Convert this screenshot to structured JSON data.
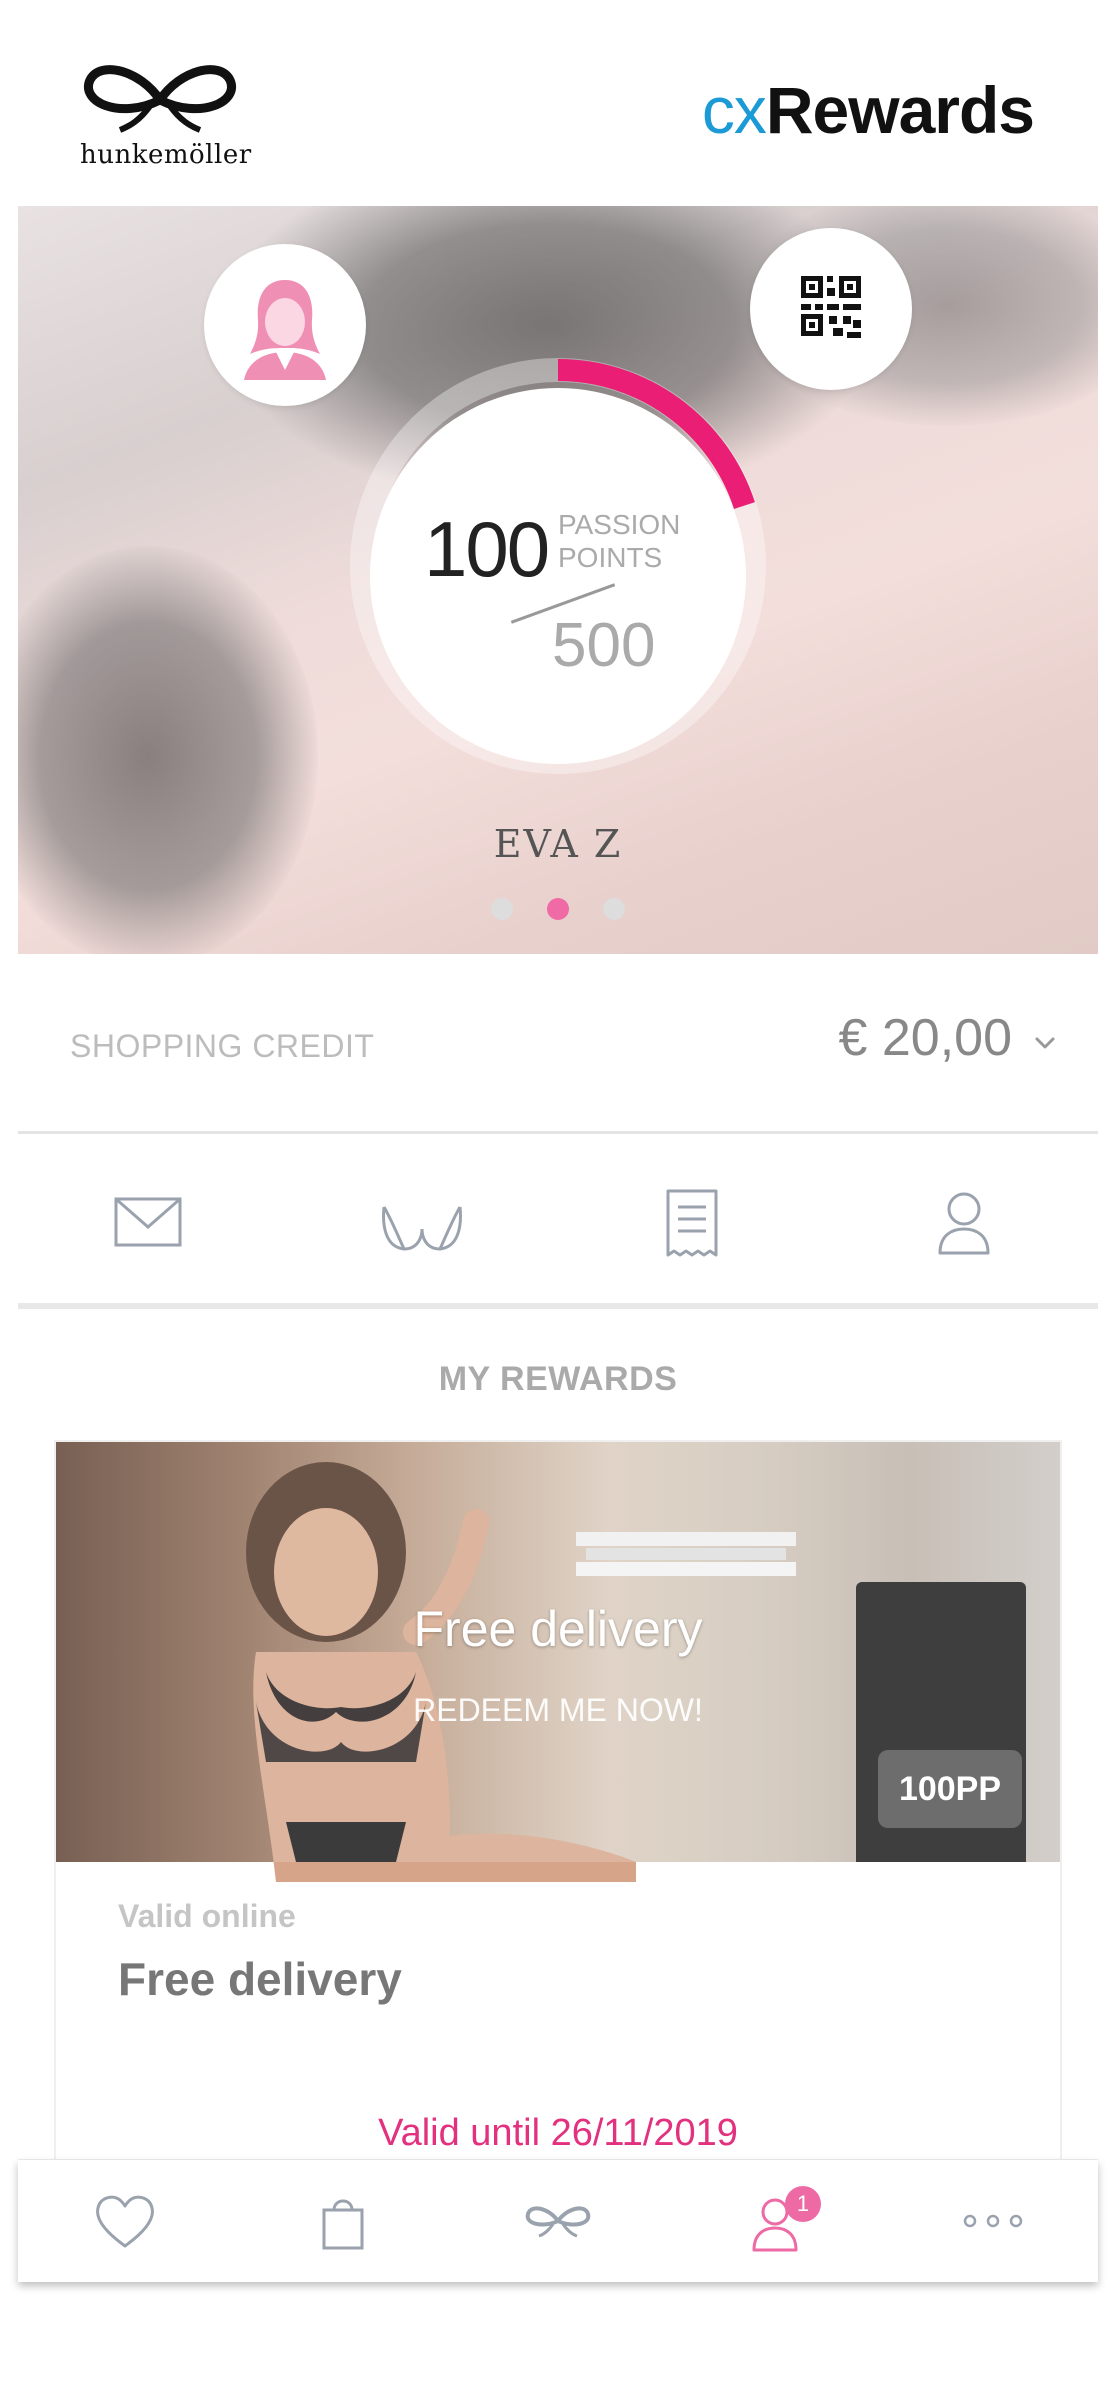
{
  "header": {
    "logo_text": "hunkemöller",
    "brand_prefix": "cx",
    "brand_suffix": "Rewards"
  },
  "profile": {
    "points_value": "100",
    "points_label_line1": "PASSION",
    "points_label_line2": "POINTS",
    "points_target": "500",
    "points_progress": 0.2,
    "member_name": "EVA  Z",
    "carousel_active_index": 1,
    "carousel_count": 3
  },
  "credit": {
    "label": "SHOPPING CREDIT",
    "amount": "€ 20,00"
  },
  "tabs": [
    {
      "icon": "envelope-icon"
    },
    {
      "icon": "bra-icon"
    },
    {
      "icon": "receipt-icon"
    },
    {
      "icon": "person-icon"
    }
  ],
  "rewards": {
    "section_title": "MY REWARDS",
    "cards": [
      {
        "promo_title": "Free delivery",
        "promo_subtitle": "REDEEM ME NOW!",
        "points_cost": "100PP",
        "valid_where": "Valid online",
        "title": "Free delivery",
        "valid_until": "Valid until 26/11/2019"
      }
    ]
  },
  "bottom_nav": {
    "items": [
      {
        "icon": "heart-icon"
      },
      {
        "icon": "shopping-bag-icon"
      },
      {
        "icon": "bow-logo-icon"
      },
      {
        "icon": "profile-icon",
        "badge": "1"
      },
      {
        "icon": "more-icon"
      }
    ]
  },
  "colors": {
    "accent_pink": "#e2317e",
    "brand_blue": "#1b9ad6",
    "ring_pink": "#e91e74"
  }
}
